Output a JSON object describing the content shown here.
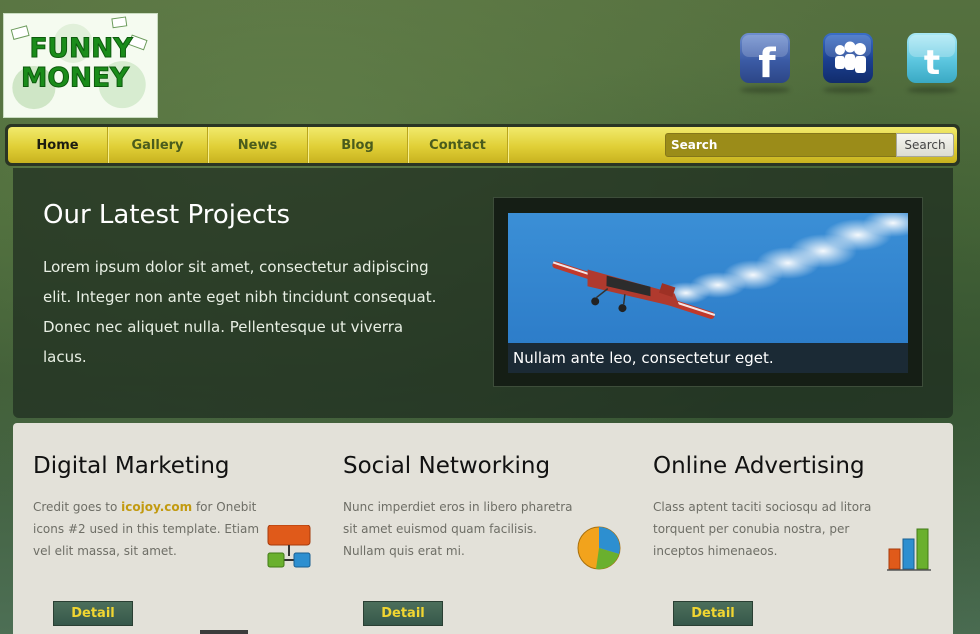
{
  "logo": {
    "line1": "FUNNY",
    "line2": "MONEY"
  },
  "social": [
    {
      "name": "facebook",
      "glyph": "f"
    },
    {
      "name": "myspace",
      "glyph": "myspace"
    },
    {
      "name": "twitter",
      "glyph": "t"
    }
  ],
  "nav": {
    "items": [
      "Home",
      "Gallery",
      "News",
      "Blog",
      "Contact"
    ],
    "active": "Home",
    "search_placeholder": "Search",
    "search_button": "Search"
  },
  "featured": {
    "title": "Our Latest Projects",
    "text": "Lorem ipsum dolor sit amet, consectetur adipiscing elit. Integer non ante eget nibh tincidunt consequat. Donec nec aliquet nulla. Pellentesque ut viverra lacus.",
    "caption": "Nullam ante leo, consectetur eget."
  },
  "columns": [
    {
      "title": "Digital Marketing",
      "text_before": "Credit goes to ",
      "link": "icojoy.com",
      "text_after": " for Onebit icons #2 used in this template. Etiam vel elit massa, sit amet.",
      "button": "Detail",
      "icon": "network-icon"
    },
    {
      "title": "Social Networking",
      "text_before": "Nunc imperdiet eros in libero pharetra sit amet euismod quam facilisis. Nullam quis erat mi.",
      "link": "",
      "text_after": "",
      "button": "Detail",
      "icon": "pie-chart-icon"
    },
    {
      "title": "Online Advertising",
      "text_before": "Class aptent taciti sociosqu ad litora torquent per conubia nostra, per inceptos himenaeos.",
      "link": "",
      "text_after": "",
      "button": "Detail",
      "icon": "bar-chart-icon"
    }
  ],
  "colors": {
    "nav_yellow": "#e0cf36",
    "accent_link": "#c29a10",
    "detail_text": "#f1d631"
  }
}
